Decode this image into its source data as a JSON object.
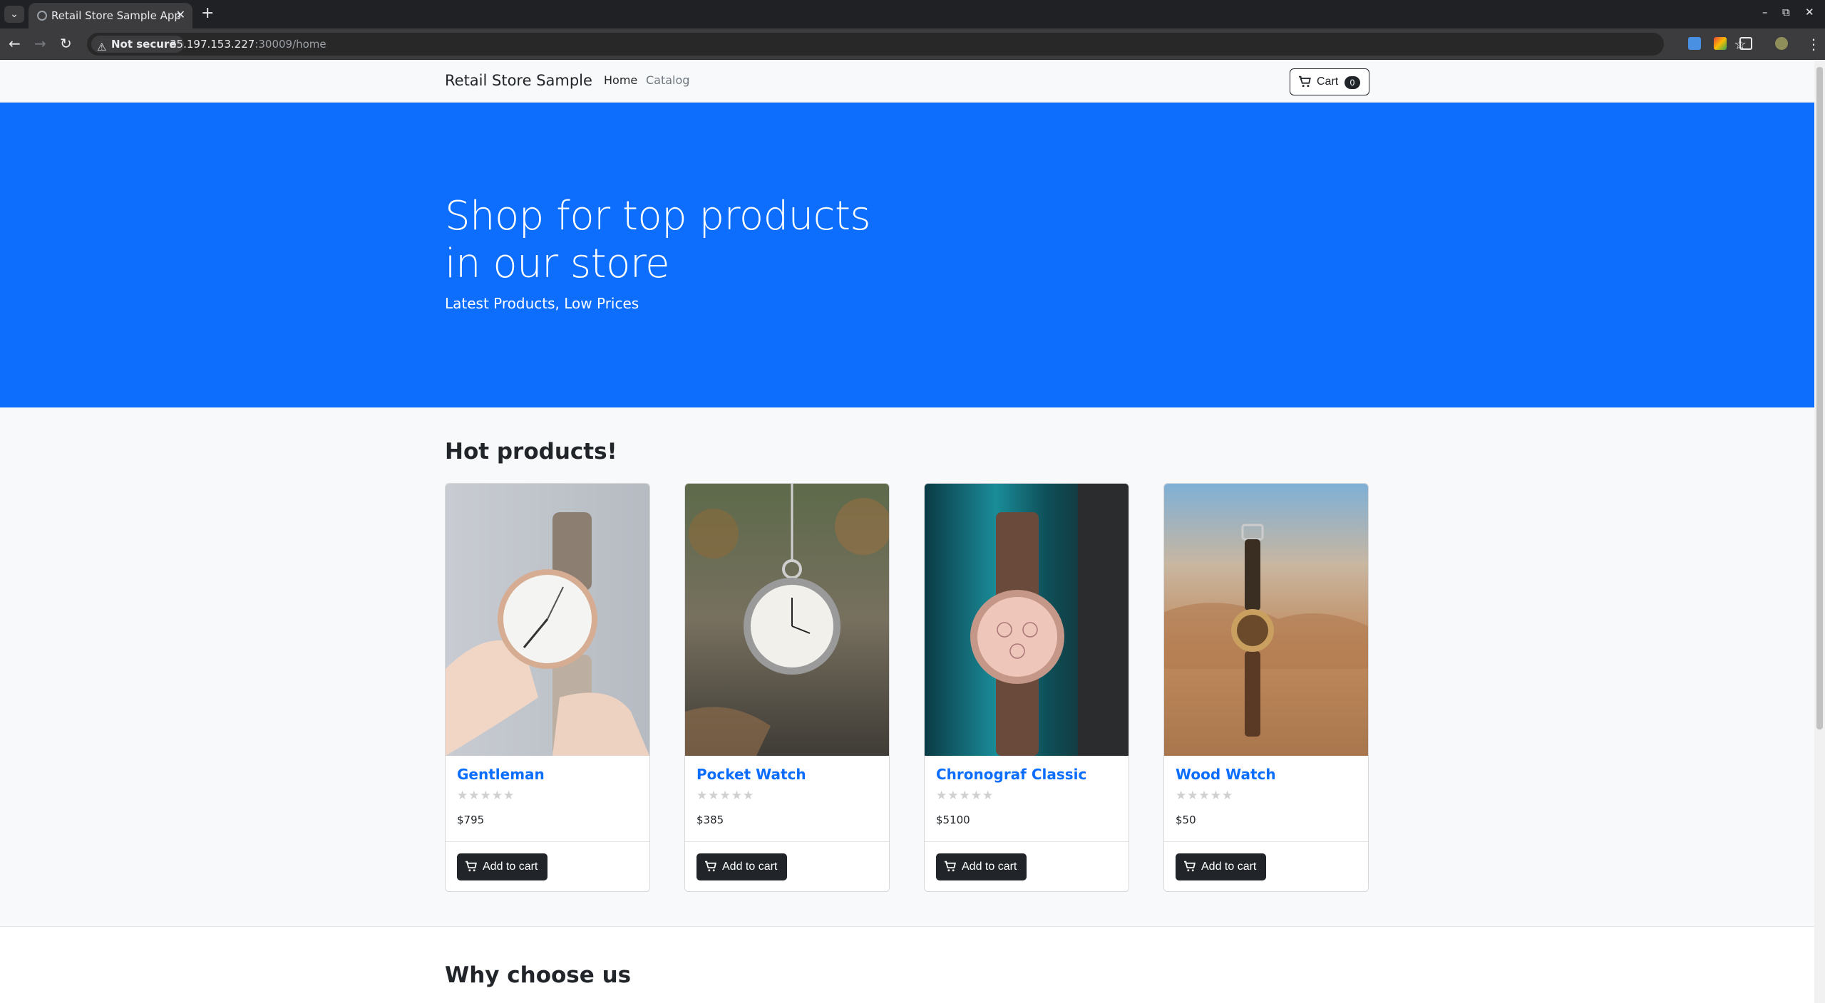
{
  "browser": {
    "tab_title": "Retail Store Sample App",
    "url_host": "35.197.153.227",
    "url_path": ":30009/home",
    "security_label": "Not secure"
  },
  "navbar": {
    "brand": "Retail Store Sample",
    "links": [
      "Home",
      "Catalog"
    ],
    "cart_label": "Cart",
    "cart_count": "0"
  },
  "hero": {
    "title_line1": "Shop for top products",
    "title_line2": "in our store",
    "subtitle": "Latest Products, Low Prices"
  },
  "hot": {
    "title": "Hot products!",
    "button_label": "Add to cart",
    "products": [
      {
        "name": "Gentleman",
        "price": "$795",
        "rating": 0,
        "image": "wrist watch held in hand"
      },
      {
        "name": "Pocket Watch",
        "price": "$385",
        "rating": 0,
        "image": "hanging pocket watch"
      },
      {
        "name": "Chronograf Classic",
        "price": "$5100",
        "rating": 0,
        "image": "rose gold chronograph on teal fabric"
      },
      {
        "name": "Wood Watch",
        "price": "$50",
        "rating": 0,
        "image": "wood watch over desert"
      }
    ]
  },
  "why": {
    "title": "Why choose us"
  },
  "colors": {
    "primary": "#0d6efd",
    "dark": "#212529"
  }
}
